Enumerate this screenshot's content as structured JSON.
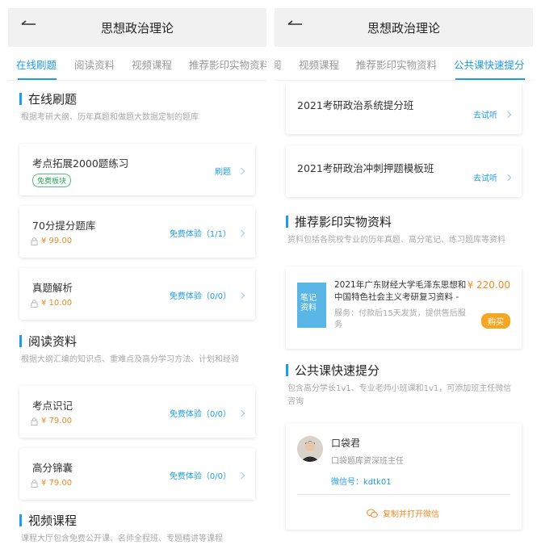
{
  "left": {
    "nav_title": "思想政治理论",
    "tabs": [
      "在线刷题",
      "阅读资料",
      "视频课程",
      "推荐影印实物资料"
    ],
    "section1": {
      "title": "在线刷题",
      "desc": "根据考研大纲、历年真题和做题大数据定制的题库"
    },
    "cards1": [
      {
        "title": "考点拓展2000题练习",
        "tag": "免费板块",
        "action": "刷题"
      },
      {
        "title": "70分提分题库",
        "price": "¥ 99.00",
        "action": "免费体验（1/1）"
      },
      {
        "title": "真题解析",
        "price": "¥ 10.00",
        "action": "免费体验（0/0）"
      }
    ],
    "section2": {
      "title": "阅读资料",
      "desc": "根据大纲汇编的知识点、重难点及高分学习方法、计划和经验"
    },
    "cards2": [
      {
        "title": "考点识记",
        "price": "¥ 79.00",
        "action": "免费体验（0/0）"
      },
      {
        "title": "高分锦囊",
        "price": "¥ 79.00",
        "action": "免费体验（0/0）"
      }
    ],
    "section3": {
      "title": "视频课程",
      "desc": "课程大厅包含免费公开课、名师全程班、专题精讲等课程"
    }
  },
  "right": {
    "nav_title": "思想政治理论",
    "tabs": [
      "阅",
      "视频课程",
      "推荐影印实物资料",
      "公共课快速提分"
    ],
    "course_cards": [
      {
        "title": "2021考研政治系统提分班",
        "action": "去试听"
      },
      {
        "title": "2021考研政治冲刺押题模板班",
        "action": "去试听"
      }
    ],
    "section_print": {
      "title": "推荐影印实物资料",
      "desc": "资料包括各院校专业的历年真题、高分笔记、练习题库等资料"
    },
    "print_card": {
      "cover_text": [
        "笔记",
        "资料"
      ],
      "title_line1": "2021年广东财经大学毛泽东思想和",
      "title_line2": "中国特色社会主义考研复习资料 -",
      "price": "¥ 220.00",
      "service_line1": "服务：付款后15天发货，提供售后服",
      "service_line2": "务",
      "buy": "购买"
    },
    "section_public": {
      "title": "公共课快速提分",
      "desc_line1": "包含高分学长1v1、专业老师小班课和1v1，可添加班主任微信",
      "desc_line2": "咨询"
    },
    "contact": {
      "name": "口袋君",
      "role": "口袋题库资深班主任",
      "wechat": "微信号：kdtk01",
      "copy": "复制并打开微信"
    }
  },
  "colors": {
    "accent": "#1e9be9",
    "price": "#f08a24",
    "tag_green": "#2aa55a",
    "buy": "#f5a623"
  }
}
